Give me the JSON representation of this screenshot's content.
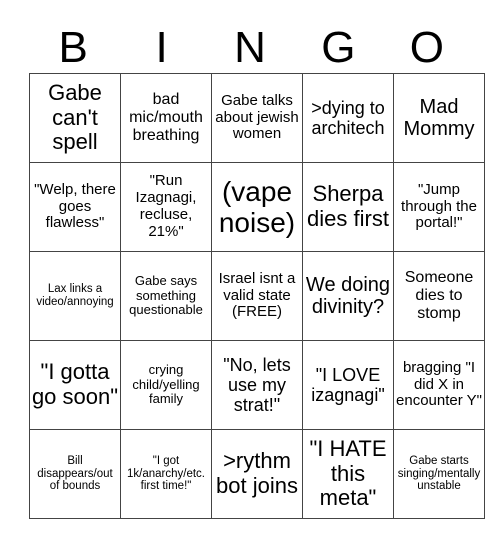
{
  "header": {
    "letters": [
      "B",
      "I",
      "N",
      "G",
      "O"
    ]
  },
  "grid": {
    "rows": [
      [
        "Gabe can't spell",
        "bad mic/mouth breathing",
        "Gabe talks about jewish women",
        ">dying to architech",
        "Mad Mommy"
      ],
      [
        "\"Welp, there goes flawless\"",
        "\"Run Izagnagi, recluse, 21%\"",
        "(vape noise)",
        "Sherpa dies first",
        "\"Jump through the portal!\""
      ],
      [
        "Lax links a video/annoying",
        "Gabe says something questionable",
        "Israel isnt a valid state (FREE)",
        "We doing divinity?",
        "Someone dies to stomp"
      ],
      [
        "\"I gotta go soon\"",
        "crying child/yelling family",
        "\"No, lets use my strat!\"",
        "\"I LOVE izagnagi\"",
        "bragging \"I did X in encounter Y\""
      ],
      [
        "Bill disappears/out of bounds",
        "\"I got 1k/anarchy/etc. first time!\"",
        ">rythm bot joins",
        "\"I HATE this meta\"",
        "Gabe starts singing/mentally unstable"
      ]
    ]
  }
}
